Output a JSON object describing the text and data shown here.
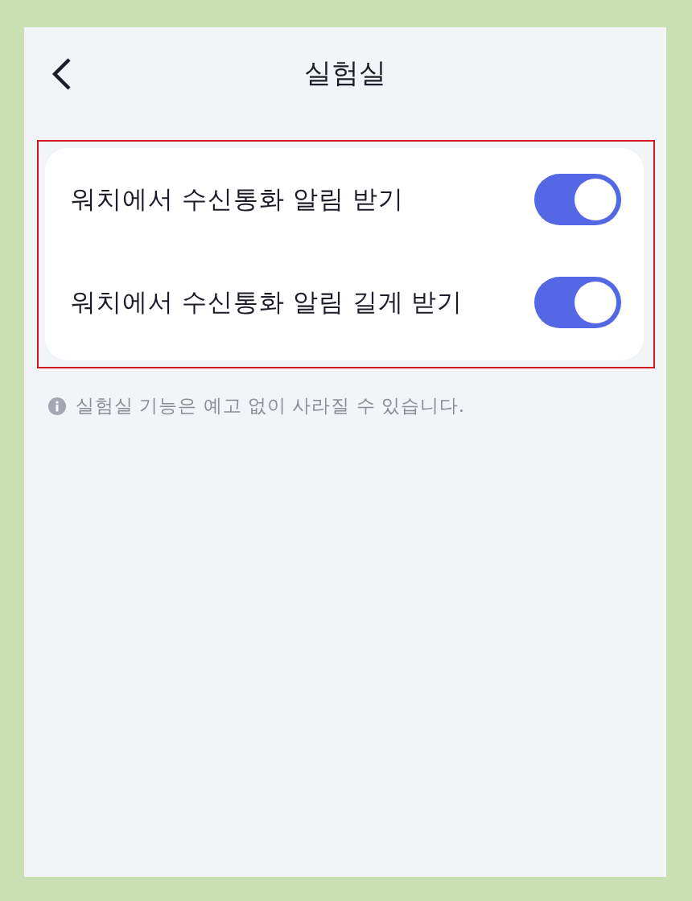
{
  "header": {
    "title": "실험실"
  },
  "settings": [
    {
      "label": "워치에서 수신통화 알림 받기",
      "on": true
    },
    {
      "label": "워치에서 수신통화 알림 길게 받기",
      "on": true
    }
  ],
  "notice": "실험실 기능은 예고 없이 사라질 수 있습니다."
}
